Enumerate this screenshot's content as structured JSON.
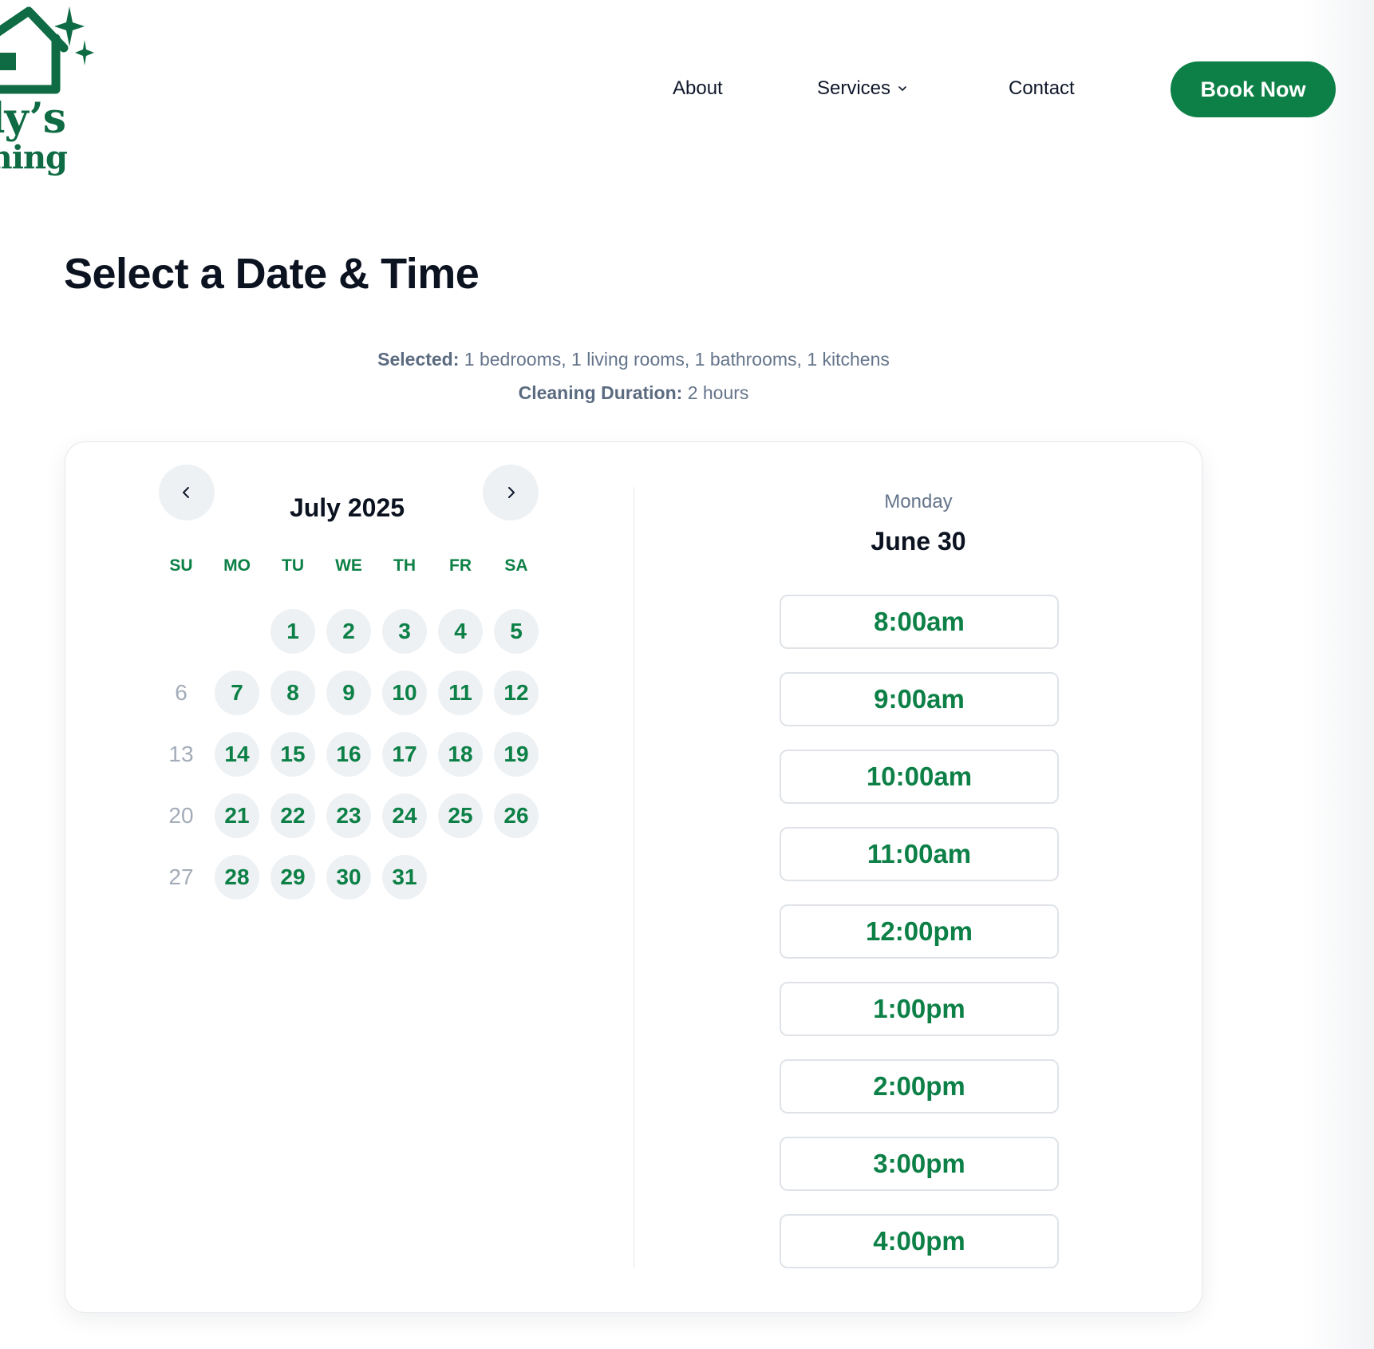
{
  "brand": {
    "line1": "ly’s",
    "line2": "aning",
    "logo_icon": "house-sparkle-icon",
    "color": "#0e6b43"
  },
  "nav": {
    "about": "About",
    "services": "Services",
    "contact": "Contact",
    "book_now": "Book Now",
    "accent": "#0c8046"
  },
  "page": {
    "title": "Select a Date & Time",
    "selected_label": "Selected:",
    "selected_value": "1 bedrooms, 1 living rooms, 1 bathrooms, 1 kitchens",
    "duration_label": "Cleaning Duration:",
    "duration_value": "2 hours"
  },
  "calendar": {
    "month_label": "July 2025",
    "prev_icon": "chevron-left-icon",
    "next_icon": "chevron-right-icon",
    "weekdays": [
      "SU",
      "MO",
      "TU",
      "WE",
      "TH",
      "FR",
      "SA"
    ],
    "first_weekday_index": 2,
    "days": [
      {
        "d": "1",
        "available": true
      },
      {
        "d": "2",
        "available": true
      },
      {
        "d": "3",
        "available": true
      },
      {
        "d": "4",
        "available": true
      },
      {
        "d": "5",
        "available": true
      },
      {
        "d": "6",
        "available": false
      },
      {
        "d": "7",
        "available": true
      },
      {
        "d": "8",
        "available": true
      },
      {
        "d": "9",
        "available": true
      },
      {
        "d": "10",
        "available": true
      },
      {
        "d": "11",
        "available": true
      },
      {
        "d": "12",
        "available": true
      },
      {
        "d": "13",
        "available": false
      },
      {
        "d": "14",
        "available": true
      },
      {
        "d": "15",
        "available": true
      },
      {
        "d": "16",
        "available": true
      },
      {
        "d": "17",
        "available": true
      },
      {
        "d": "18",
        "available": true
      },
      {
        "d": "19",
        "available": true
      },
      {
        "d": "20",
        "available": false
      },
      {
        "d": "21",
        "available": true
      },
      {
        "d": "22",
        "available": true
      },
      {
        "d": "23",
        "available": true
      },
      {
        "d": "24",
        "available": true
      },
      {
        "d": "25",
        "available": true
      },
      {
        "d": "26",
        "available": true
      },
      {
        "d": "27",
        "available": false
      },
      {
        "d": "28",
        "available": true
      },
      {
        "d": "29",
        "available": true
      },
      {
        "d": "30",
        "available": true
      },
      {
        "d": "31",
        "available": true
      }
    ]
  },
  "slots": {
    "weekday": "Monday",
    "date": "June 30",
    "times": [
      "8:00am",
      "9:00am",
      "10:00am",
      "11:00am",
      "12:00pm",
      "1:00pm",
      "2:00pm",
      "3:00pm",
      "4:00pm"
    ]
  }
}
